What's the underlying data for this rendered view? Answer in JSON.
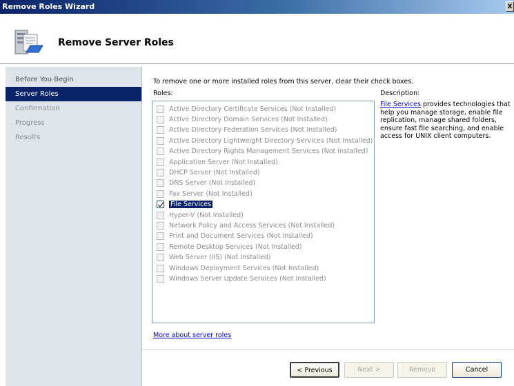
{
  "window": {
    "title": "Remove Roles Wizard",
    "close_glyph": "X"
  },
  "header": {
    "title": "Remove Server Roles",
    "icon": "server-icon"
  },
  "steps": [
    {
      "label": "Before You Begin",
      "state": "normal"
    },
    {
      "label": "Server Roles",
      "state": "active"
    },
    {
      "label": "Confirmation",
      "state": "disabled"
    },
    {
      "label": "Progress",
      "state": "disabled"
    },
    {
      "label": "Results",
      "state": "disabled"
    }
  ],
  "main": {
    "instruction": "To remove one or more installed roles from this server, clear their check boxes.",
    "roles_label": "Roles:",
    "description_label": "Description:",
    "description_link": "File Services",
    "description_text": " provides technologies that help you manage storage, enable file replication, manage shared folders, ensure fast file searching, and enable access for UNIX client computers.",
    "more_link": "More about server roles"
  },
  "roles": [
    {
      "label": "Active Directory Certificate Services  (Not Installed)",
      "checked": false,
      "enabled": false
    },
    {
      "label": "Active Directory Domain Services  (Not Installed)",
      "checked": false,
      "enabled": false
    },
    {
      "label": "Active Directory Federation Services  (Not Installed)",
      "checked": false,
      "enabled": false
    },
    {
      "label": "Active Directory Lightweight Directory Services  (Not Installed)",
      "checked": false,
      "enabled": false
    },
    {
      "label": "Active Directory Rights Management Services  (Not Installed)",
      "checked": false,
      "enabled": false
    },
    {
      "label": "Application Server  (Not Installed)",
      "checked": false,
      "enabled": false
    },
    {
      "label": "DHCP Server  (Not Installed)",
      "checked": false,
      "enabled": false
    },
    {
      "label": "DNS Server  (Not Installed)",
      "checked": false,
      "enabled": false
    },
    {
      "label": "Fax Server  (Not Installed)",
      "checked": false,
      "enabled": false
    },
    {
      "label": "File Services",
      "checked": true,
      "enabled": true
    },
    {
      "label": "Hyper-V  (Not Installed)",
      "checked": false,
      "enabled": false
    },
    {
      "label": "Network Policy and Access Services  (Not Installed)",
      "checked": false,
      "enabled": false
    },
    {
      "label": "Print and Document Services  (Not Installed)",
      "checked": false,
      "enabled": false
    },
    {
      "label": "Remote Desktop Services  (Not Installed)",
      "checked": false,
      "enabled": false
    },
    {
      "label": "Web Server (IIS)  (Not Installed)",
      "checked": false,
      "enabled": false
    },
    {
      "label": "Windows Deployment Services  (Not Installed)",
      "checked": false,
      "enabled": false
    },
    {
      "label": "Windows Server Update Services  (Not Installed)",
      "checked": false,
      "enabled": false
    }
  ],
  "buttons": {
    "previous": "< Previous",
    "next": "Next >",
    "remove": "Remove",
    "cancel": "Cancel"
  }
}
